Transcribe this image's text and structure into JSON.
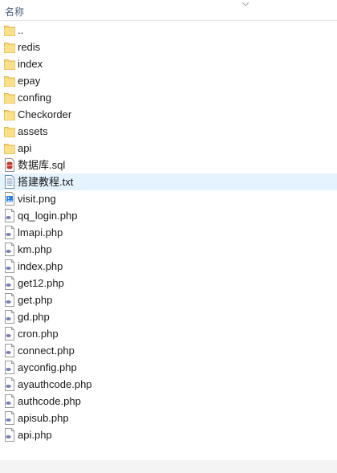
{
  "header": {
    "name_column": "名称"
  },
  "files": [
    {
      "name": "..",
      "type": "folder"
    },
    {
      "name": "redis",
      "type": "folder"
    },
    {
      "name": "index",
      "type": "folder"
    },
    {
      "name": "epay",
      "type": "folder"
    },
    {
      "name": "confing",
      "type": "folder"
    },
    {
      "name": "Checkorder",
      "type": "folder"
    },
    {
      "name": "assets",
      "type": "folder"
    },
    {
      "name": "api",
      "type": "folder"
    },
    {
      "name": "数据库.sql",
      "type": "sql"
    },
    {
      "name": "搭建教程.txt",
      "type": "txt",
      "selected": true
    },
    {
      "name": "visit.png",
      "type": "png"
    },
    {
      "name": "qq_login.php",
      "type": "php"
    },
    {
      "name": "lmapi.php",
      "type": "php"
    },
    {
      "name": "km.php",
      "type": "php"
    },
    {
      "name": "index.php",
      "type": "php"
    },
    {
      "name": "get12.php",
      "type": "php"
    },
    {
      "name": "get.php",
      "type": "php"
    },
    {
      "name": "gd.php",
      "type": "php"
    },
    {
      "name": "cron.php",
      "type": "php"
    },
    {
      "name": "connect.php",
      "type": "php"
    },
    {
      "name": "ayconfig.php",
      "type": "php"
    },
    {
      "name": "ayauthcode.php",
      "type": "php"
    },
    {
      "name": "authcode.php",
      "type": "php"
    },
    {
      "name": "apisub.php",
      "type": "php"
    },
    {
      "name": "api.php",
      "type": "php"
    }
  ],
  "icons": {
    "folder": "folder-icon",
    "sql": "sql-file-icon",
    "txt": "text-file-icon",
    "png": "image-file-icon",
    "php": "php-file-icon"
  },
  "colors": {
    "folder": "#f8d775",
    "selection": "#e5f3ff",
    "header_text": "#4c607a"
  }
}
